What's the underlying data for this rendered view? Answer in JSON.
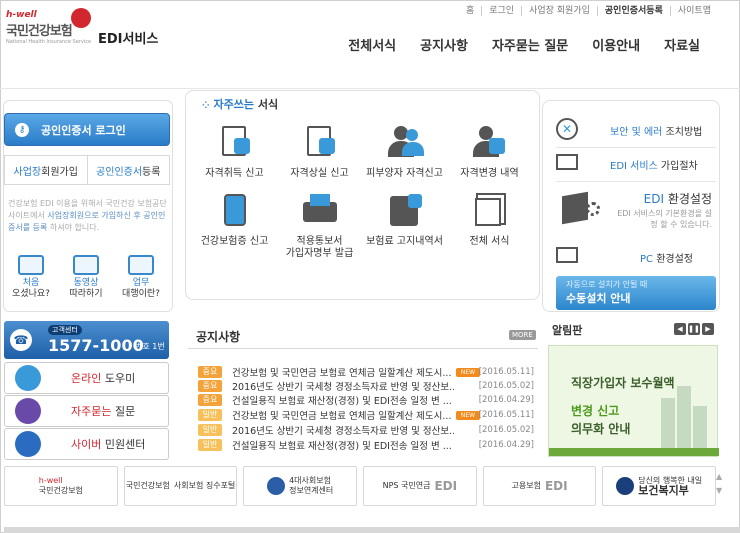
{
  "util_links": [
    "홈",
    "로그인",
    "사업장 회원가입",
    "공인인증서등록",
    "사이트맵"
  ],
  "logo": {
    "hwell": "h-well",
    "name": "국민건강보험",
    "en": "National Health Insurance Service"
  },
  "service_title": "EDI서비스",
  "gnb": [
    "전체서식",
    "공지사항",
    "자주묻는 질문",
    "이용안내",
    "자료실"
  ],
  "left": {
    "cert_login": "공인인증서 로그인",
    "register_member": {
      "blue": "사업장",
      "rest": " 회원가입"
    },
    "register_cert": {
      "blue": "공인인증서",
      "rest": " 등록"
    },
    "desc_pre": "건강보험 EDI 이용을 위해서 국민건강 보험공단 사이트에서 ",
    "desc_blue1": "사업장회원으로 가입하신 후 공인인증서를 등록",
    "desc_post": " 하셔야 합니다.",
    "quick": [
      {
        "blue": "처음",
        "rest": "오셨나요?"
      },
      {
        "blue": "동영상",
        "rest": "따라하기"
      },
      {
        "blue": "업무",
        "rest": "대행이란?"
      }
    ]
  },
  "forms": {
    "title_blue": "자주쓰는",
    "title_rest": " 서식",
    "items": [
      {
        "label": "자격취득 신고",
        "icon": "doc-pen-icon"
      },
      {
        "label": "자격상실 신고",
        "icon": "doc-x-icon"
      },
      {
        "label": "피부양자 자격신고",
        "icon": "family-icon"
      },
      {
        "label": "자격변경 내역",
        "icon": "person-chat-icon"
      },
      {
        "label": "건강보험증 신고",
        "icon": "card-icon"
      },
      {
        "label": "적용통보서\n가입자명부 발급",
        "icon": "printer-icon"
      },
      {
        "label": "보험료 고지내역서",
        "icon": "calculator-icon"
      },
      {
        "label": "전체 서식",
        "icon": "documents-icon"
      }
    ]
  },
  "right": {
    "security": {
      "blue": "보안 및 에러",
      "rest": " 조치방법"
    },
    "edi_install": {
      "blue": "EDI 서비스",
      "rest": " 가입절차"
    },
    "edi_env_blue": "EDI",
    "edi_env_rest": " 환경설정",
    "edi_env_desc": "EDI 서비스의 기본환경을 설정 할 수 있습니다.",
    "pc_env": {
      "blue": "PC",
      "rest": " 환경설정"
    },
    "install_small": "자동으로 설치가 안될 때",
    "install_big": "수동설치 안내"
  },
  "customer": {
    "label": "고객센터",
    "number": "1577-1000",
    "sub": "번호 1번",
    "items": [
      {
        "red": "온라인",
        "rest": " 도우미",
        "icon": "helper-icon"
      },
      {
        "red": "자주묻는",
        "rest": " 질문",
        "icon": "question-icon"
      },
      {
        "red": "사이버",
        "rest": " 민원센터",
        "icon": "people-icon"
      }
    ]
  },
  "notice": {
    "title": "공지사항",
    "more": "MORE",
    "rows": [
      {
        "tag": "중요",
        "text": "건강보험 및 국민연금 보험료 연체금 일할계산 제도시...",
        "new": "NEW",
        "date": "[2016.05.11]"
      },
      {
        "tag": "중요",
        "text": "2016년도 상반기 국세청 경정소득자료 반영 및 정산보...",
        "new": "",
        "date": "[2016.05.02]"
      },
      {
        "tag": "중요",
        "text": "건설일용직 보험료 재산정(경정) 및 EDI전송 일정 변 ...",
        "new": "",
        "date": "[2016.04.29]"
      },
      {
        "tag": "일반",
        "text": "건강보험 및 국민연금 보험료 연체금 일할계산 제도시...",
        "new": "NEW",
        "date": "[2016.05.11]"
      },
      {
        "tag": "일반",
        "text": "2016년도 상반기 국세청 경정소득자료 반영 및 정산보...",
        "new": "",
        "date": "[2016.05.02]"
      },
      {
        "tag": "일반",
        "text": "건설일용직 보험료 재산정(경정) 및 EDI전송 일정 변 ...",
        "new": "",
        "date": "[2016.04.29]"
      }
    ]
  },
  "alarm": {
    "title": "알림판",
    "line1": "직장가입자 보수월액",
    "line2_green": "변경 신고",
    "line3": "의무화 안내"
  },
  "banners": [
    {
      "small": "h-well",
      "big": "국민건강보험"
    },
    {
      "small": "국민건강보험",
      "big": "사회보험 징수포털"
    },
    {
      "small": "4대사회보험",
      "big": "정보연계센터"
    },
    {
      "small": "NPS 국민연금",
      "big": "EDI"
    },
    {
      "small": "고용보험",
      "big": "EDI"
    },
    {
      "small": "당신의 행복한 내일",
      "big": "보건복지부"
    }
  ],
  "colors": {
    "brand_blue": "#2a7cc9",
    "brand_red": "#d3272f",
    "tag_important": "#f3a33a",
    "tag_general": "#f6c15a"
  }
}
